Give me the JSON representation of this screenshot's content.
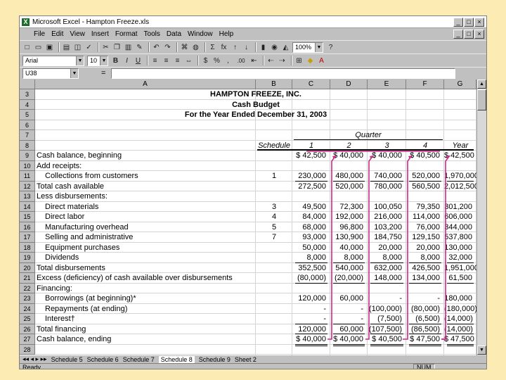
{
  "window": {
    "title": "Microsoft Excel - Hampton Freeze.xls",
    "app_icon": "X",
    "buttons": [
      "_",
      "□",
      "×"
    ],
    "doc_buttons": [
      "_",
      "□",
      "×"
    ]
  },
  "menu": [
    "File",
    "Edit",
    "View",
    "Insert",
    "Format",
    "Tools",
    "Data",
    "Window",
    "Help"
  ],
  "toolbar": {
    "zoom": "100%",
    "font": "Arial",
    "font_size": "10",
    "bold": "B",
    "italic": "I",
    "underline": "U",
    "sigma": "Σ",
    "fx": "fx",
    "percent": "%",
    "comma": ",",
    "dec": ".00"
  },
  "formula_bar": {
    "name_box": "U38",
    "equals": "="
  },
  "columns": [
    "A",
    "B",
    "C",
    "D",
    "E",
    "F",
    "G"
  ],
  "rows": [
    "3",
    "4",
    "5",
    "6",
    "7",
    "8",
    "9",
    "10",
    "11",
    "12",
    "13",
    "14",
    "15",
    "16",
    "17",
    "18",
    "19",
    "20",
    "21",
    "22",
    "23",
    "24",
    "25",
    "26",
    "27",
    "28"
  ],
  "sheet": {
    "company": "HAMPTON FREEZE, INC.",
    "report": "Cash Budget",
    "period": "For the Year Ended December 31, 2003",
    "quarter_label": "Quarter",
    "schedule_label": "Schedule",
    "quarters": [
      "1",
      "2",
      "3",
      "4",
      "Year"
    ],
    "lines": [
      {
        "label": "Cash balance, beginning",
        "indent": 0,
        "schedule": "",
        "values": [
          "$ 42,500",
          "$ 40,000",
          "$ 40,000",
          "$ 40,500",
          "$ 42,500"
        ]
      },
      {
        "label": "Add receipts:",
        "indent": 0,
        "schedule": "",
        "values": [
          "",
          "",
          "",
          "",
          ""
        ]
      },
      {
        "label": "Collections from customers",
        "indent": 1,
        "schedule": "1",
        "values": [
          "230,000",
          "480,000",
          "740,000",
          "520,000",
          "1,970,000"
        ]
      },
      {
        "label": "Total cash available",
        "indent": 0,
        "schedule": "",
        "values": [
          "272,500",
          "520,000",
          "780,000",
          "560,500",
          "2,012,500"
        ]
      },
      {
        "label": "Less disbursements:",
        "indent": 0,
        "schedule": "",
        "values": [
          "",
          "",
          "",
          "",
          ""
        ]
      },
      {
        "label": "Direct materials",
        "indent": 1,
        "schedule": "3",
        "values": [
          "49,500",
          "72,300",
          "100,050",
          "79,350",
          "301,200"
        ]
      },
      {
        "label": "Direct labor",
        "indent": 1,
        "schedule": "4",
        "values": [
          "84,000",
          "192,000",
          "216,000",
          "114,000",
          "606,000"
        ]
      },
      {
        "label": "Manufacturing overhead",
        "indent": 1,
        "schedule": "5",
        "values": [
          "68,000",
          "96,800",
          "103,200",
          "76,000",
          "344,000"
        ]
      },
      {
        "label": "Selling and administrative",
        "indent": 1,
        "schedule": "7",
        "values": [
          "93,000",
          "130,900",
          "184,750",
          "129,150",
          "537,800"
        ]
      },
      {
        "label": "Equipment purchases",
        "indent": 1,
        "schedule": "",
        "values": [
          "50,000",
          "40,000",
          "20,000",
          "20,000",
          "130,000"
        ]
      },
      {
        "label": "Dividends",
        "indent": 1,
        "schedule": "",
        "values": [
          "8,000",
          "8,000",
          "8,000",
          "8,000",
          "32,000"
        ]
      },
      {
        "label": "Total disbursements",
        "indent": 0,
        "schedule": "",
        "values": [
          "352,500",
          "540,000",
          "632,000",
          "426,500",
          "1,951,000"
        ]
      },
      {
        "label": "Excess (deficiency) of cash available over disbursements",
        "indent": 0,
        "schedule": "",
        "values": [
          "(80,000)",
          "(20,000)",
          "148,000",
          "134,000",
          "61,500"
        ]
      },
      {
        "label": "Financing:",
        "indent": 0,
        "schedule": "",
        "values": [
          "",
          "",
          "",
          "",
          ""
        ]
      },
      {
        "label": "Borrowings (at beginning)*",
        "indent": 1,
        "schedule": "",
        "values": [
          "120,000",
          "60,000",
          "-",
          "-",
          "180,000"
        ]
      },
      {
        "label": "Repayments (at ending)",
        "indent": 1,
        "schedule": "",
        "values": [
          "-",
          "-",
          "(100,000)",
          "(80,000)",
          "(180,000)"
        ]
      },
      {
        "label": "Interest†",
        "indent": 1,
        "schedule": "",
        "values": [
          "-",
          "-",
          "(7,500)",
          "(6,500)",
          "(14,000)"
        ]
      },
      {
        "label": "Total financing",
        "indent": 0,
        "schedule": "",
        "values": [
          "120,000",
          "60,000",
          "(107,500)",
          "(86,500)",
          "(14,000)"
        ]
      },
      {
        "label": "Cash balance, ending",
        "indent": 0,
        "schedule": "",
        "values": [
          "$ 40,000",
          "$ 40,000",
          "$ 40,500",
          "$ 47,500",
          "$ 47,500"
        ]
      }
    ]
  },
  "tabs": [
    "Schedule 5",
    "Schedule 6",
    "Schedule 7",
    "Schedule 8",
    "Schedule 9",
    "Sheet 2"
  ],
  "active_tab": "Schedule 8",
  "status": {
    "ready": "Ready",
    "num": "NUM"
  },
  "colors": {
    "background": "#fcecb4",
    "arrow": "#cc2a8a"
  }
}
